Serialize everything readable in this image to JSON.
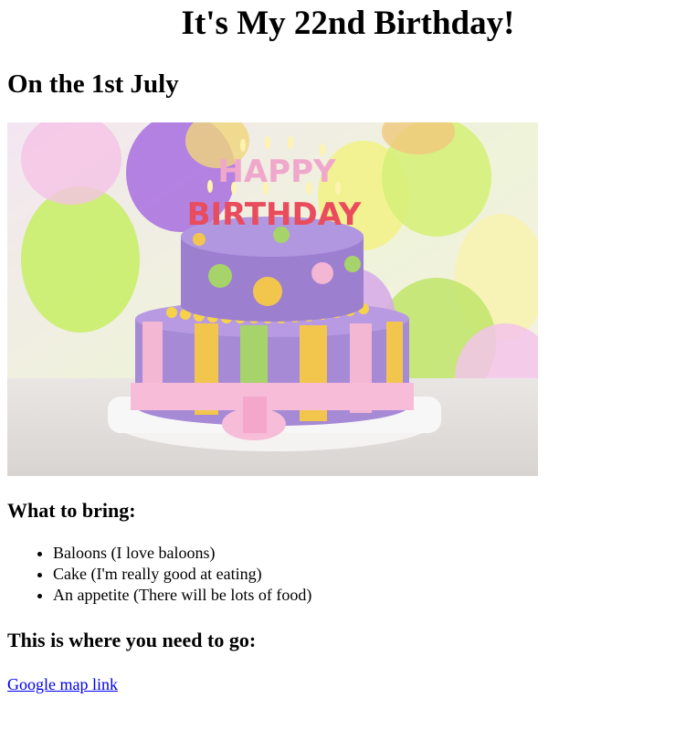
{
  "page": {
    "title": "It's My 22nd Birthday!",
    "date_heading": "On the 1st July",
    "image": {
      "alt": "Birthday cake",
      "cake_text_top": "HAPPY",
      "cake_text_bottom": "BIRTHDAY"
    },
    "bring_heading": "What to bring:",
    "bring_items": [
      "Baloons (I love baloons)",
      "Cake (I'm really good at eating)",
      "An appetite (There will be lots of food)"
    ],
    "where_heading": "This is where you need to go:",
    "map_link_label": "Google map link"
  },
  "colors": {
    "link": "#0000ee",
    "text": "#000000",
    "background": "#ffffff"
  }
}
